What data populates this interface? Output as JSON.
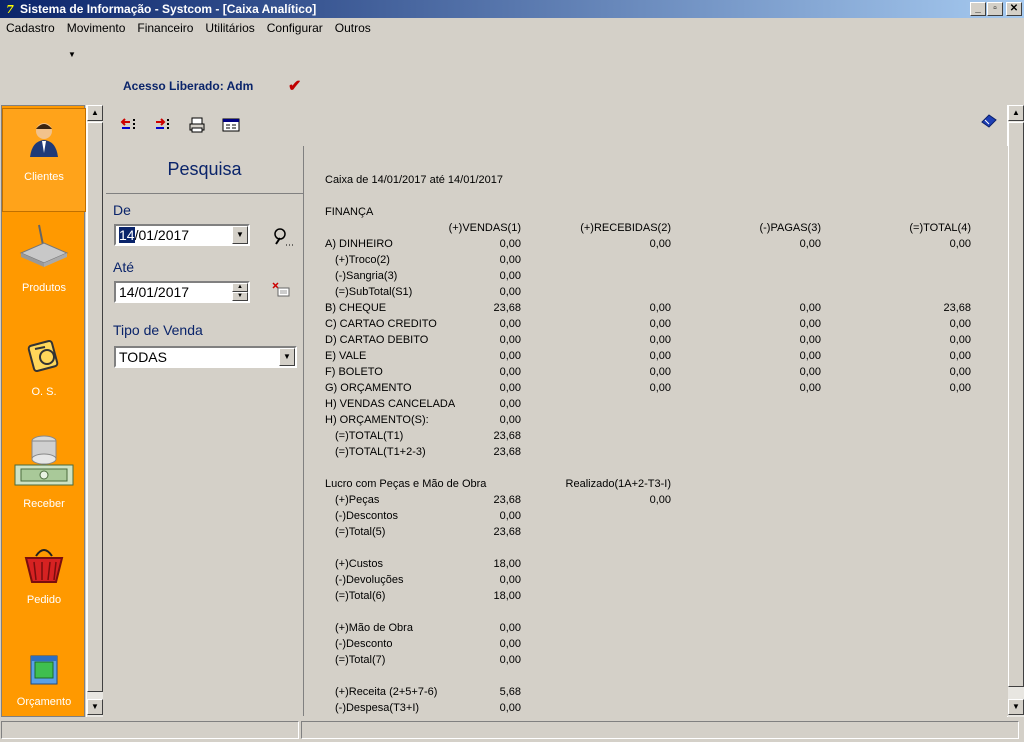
{
  "window": {
    "title": "Sistema de Informação - Systcom - [Caixa Analítico]",
    "app_icon": "7"
  },
  "menu": [
    "Cadastro",
    "Movimento",
    "Financeiro",
    "Utilitários",
    "Configurar",
    "Outros"
  ],
  "access_text": "Acesso Liberado: Adm",
  "sidebar": {
    "items": [
      {
        "label": "Clientes",
        "icon": "client-person-icon"
      },
      {
        "label": "Produtos",
        "icon": "product-box-icon"
      },
      {
        "label": "O. S.",
        "icon": "service-order-icon"
      },
      {
        "label": "Receber",
        "icon": "money-stack-icon"
      },
      {
        "label": "Pedido",
        "icon": "basket-icon"
      },
      {
        "label": "Orçamento",
        "icon": "budget-folder-icon"
      }
    ]
  },
  "search": {
    "title": "Pesquisa",
    "from_label": "De",
    "from_value_sel": "14",
    "from_value_rest": "/01/2017",
    "to_label": "Até",
    "to_value": "14/01/2017",
    "sale_type_label": "Tipo de Venda",
    "sale_type_value": "TODAS"
  },
  "report": {
    "header": "Caixa de 14/01/2017 até 14/01/2017",
    "section_title": "FINANÇA",
    "columns": [
      "(+)VENDAS(1)",
      "(+)RECEBIDAS(2)",
      "(-)PAGAS(3)",
      "(=)TOTAL(4)"
    ],
    "rows": [
      {
        "label": "A) DINHEIRO",
        "v": [
          "0,00",
          "0,00",
          "0,00",
          "0,00"
        ]
      },
      {
        "label": "(+)Troco(2)",
        "v": [
          "0,00",
          "",
          "",
          ""
        ]
      },
      {
        "label": "(-)Sangria(3)",
        "v": [
          "0,00",
          "",
          "",
          ""
        ]
      },
      {
        "label": "(=)SubTotal(S1)",
        "v": [
          "0,00",
          "",
          "",
          ""
        ]
      },
      {
        "label": "B) CHEQUE",
        "v": [
          "23,68",
          "0,00",
          "0,00",
          "23,68"
        ]
      },
      {
        "label": "C) CARTAO CREDITO",
        "v": [
          "0,00",
          "0,00",
          "0,00",
          "0,00"
        ]
      },
      {
        "label": "D) CARTAO DEBITO",
        "v": [
          "0,00",
          "0,00",
          "0,00",
          "0,00"
        ]
      },
      {
        "label": "E) VALE",
        "v": [
          "0,00",
          "0,00",
          "0,00",
          "0,00"
        ]
      },
      {
        "label": "F) BOLETO",
        "v": [
          "0,00",
          "0,00",
          "0,00",
          "0,00"
        ]
      },
      {
        "label": "G) ORÇAMENTO",
        "v": [
          "0,00",
          "0,00",
          "0,00",
          "0,00"
        ]
      },
      {
        "label": "H) VENDAS CANCELADAS",
        "v": [
          "0,00",
          "",
          "",
          ""
        ]
      },
      {
        "label": "H) ORÇAMENTO(S):",
        "v": [
          "0,00",
          "",
          "",
          ""
        ]
      },
      {
        "label": "(=)TOTAL(T1)",
        "v": [
          "23,68",
          "",
          "",
          ""
        ]
      },
      {
        "label": "(=)TOTAL(T1+2-3)",
        "v": [
          "23,68",
          "",
          "",
          ""
        ]
      }
    ],
    "profit_title": "Lucro com Peças e Mão de Obra",
    "realized_label": "Realizado(1A+2-T3-I)",
    "realized_value": "0,00",
    "profit_rows": [
      {
        "label": "(+)Peças",
        "v": "23,68"
      },
      {
        "label": "(-)Descontos",
        "v": "0,00"
      },
      {
        "label": "(=)Total(5)",
        "v": "23,68"
      },
      {
        "label": "(+)Custos",
        "v": "18,00"
      },
      {
        "label": "(-)Devoluções",
        "v": "0,00"
      },
      {
        "label": "(=)Total(6)",
        "v": "18,00"
      },
      {
        "label": "(+)Mão de Obra",
        "v": "0,00"
      },
      {
        "label": "(-)Desconto",
        "v": "0,00"
      },
      {
        "label": "(=)Total(7)",
        "v": "0,00"
      },
      {
        "label": "(+)Receita (2+5+7-6)",
        "v": "5,68"
      },
      {
        "label": "(-)Despesa(T3+I)",
        "v": "0,00"
      }
    ]
  }
}
